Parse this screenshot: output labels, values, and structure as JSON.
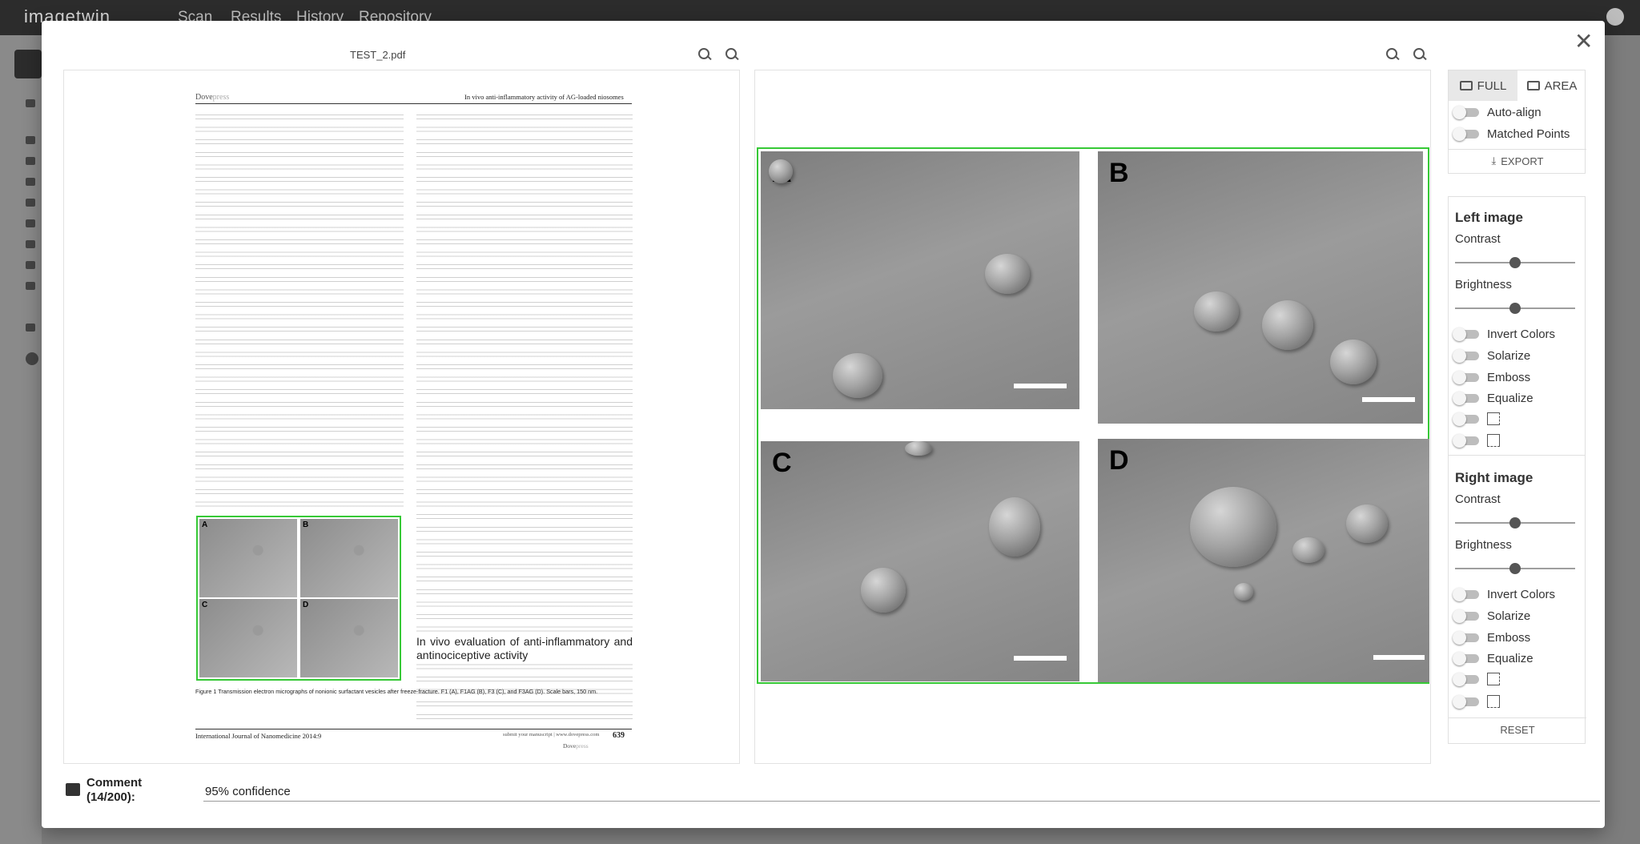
{
  "app": {
    "logo": "imagetwin",
    "nav": [
      "Scan",
      "Results",
      "History",
      "Repository"
    ]
  },
  "modal": {
    "left_viewer": {
      "file_name": "TEST_2.pdf"
    },
    "pdf_page": {
      "header_brand_left": "Dove",
      "header_brand_right": "press",
      "header_title": "In vivo anti-inflammatory activity of AG-loaded niosomes",
      "section_heading": "In vivo evaluation of anti-inflammatory and antinociceptive activity",
      "figure_labels": [
        "A",
        "B",
        "C",
        "D"
      ],
      "figure_caption": "Figure 1 Transmission electron micrographs of nonionic surfactant vesicles after freeze-fracture. F1 (A), F1AG (B), F3 (C), and F3AG (D). Scale bars, 150 nm.",
      "footer_journal": "International Journal of Nanomedicine 2014:9",
      "footer_middle": "submit your manuscript | www.dovepress.com",
      "footer_brand_left": "Dove",
      "footer_brand_right": "press",
      "page_number": "639"
    },
    "right_viewer": {
      "panel_labels": [
        "A",
        "B",
        "C",
        "D"
      ]
    },
    "tools": {
      "mode_full": "FULL",
      "mode_area": "AREA",
      "auto_align": "Auto-align",
      "matched_points": "Matched Points",
      "export": "EXPORT",
      "left_image": {
        "title": "Left image",
        "contrast": "Contrast",
        "brightness": "Brightness",
        "contrast_value": 0.5,
        "brightness_value": 0.5,
        "invert": "Invert Colors",
        "solarize": "Solarize",
        "emboss": "Emboss",
        "equalize": "Equalize"
      },
      "right_image": {
        "title": "Right image",
        "contrast": "Contrast",
        "brightness": "Brightness",
        "contrast_value": 0.5,
        "brightness_value": 0.5,
        "invert": "Invert Colors",
        "solarize": "Solarize",
        "emboss": "Emboss",
        "equalize": "Equalize"
      },
      "reset": "RESET"
    },
    "comment": {
      "label_line1": "Comment",
      "label_line2": "(14/200):",
      "value": "95% confidence"
    }
  },
  "colors": {
    "match_border": "#36c936",
    "topbar": "#2c2c2c"
  }
}
